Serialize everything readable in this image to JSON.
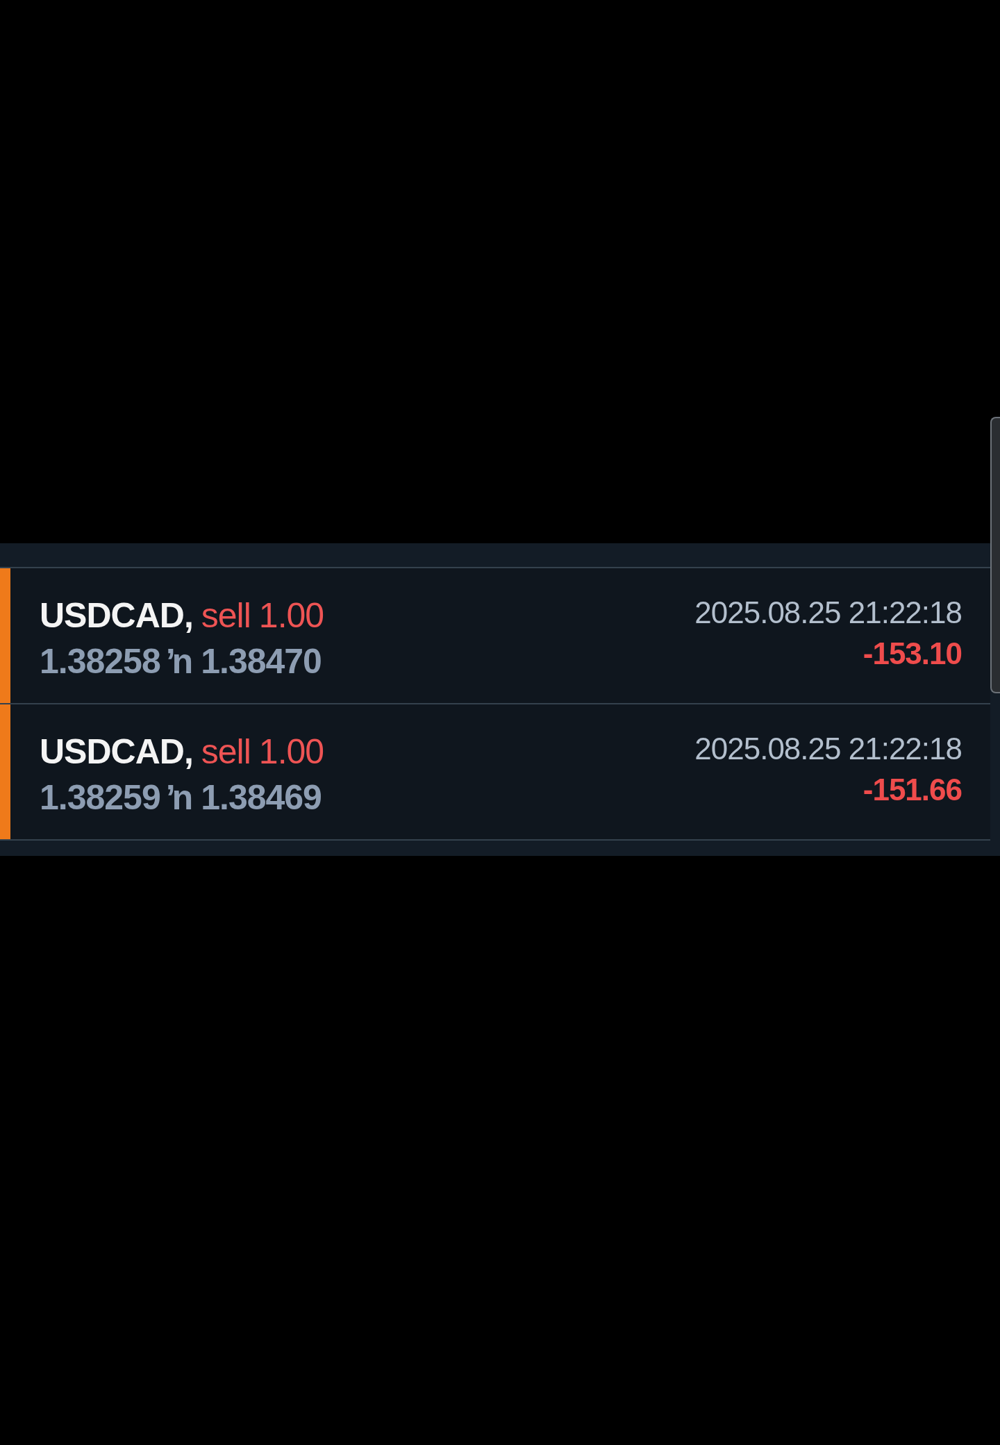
{
  "positions": [
    {
      "symbol": "USDCAD,",
      "type": "sell",
      "volume": "1.00",
      "open_price": "1.38258",
      "arrow": "ŉ",
      "close_price": "1.38470",
      "time": "2025.08.25 21:22:18",
      "profit": "-153.10"
    },
    {
      "symbol": "USDCAD,",
      "type": "sell",
      "volume": "1.00",
      "open_price": "1.38259",
      "arrow": "ŉ",
      "close_price": "1.38469",
      "time": "2025.08.25 21:22:18",
      "profit": "-151.66"
    }
  ]
}
